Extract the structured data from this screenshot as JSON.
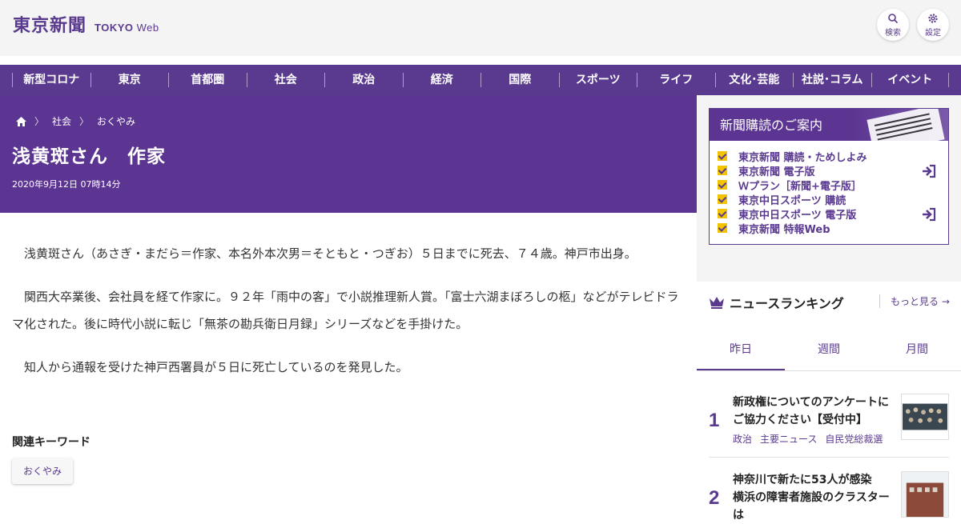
{
  "header": {
    "logo_jp": "東京新聞",
    "logo_en_bold": "TOKYO",
    "logo_en_light": "Web",
    "search_label": "検索",
    "settings_label": "設定"
  },
  "nav": [
    "新型コロナ",
    "東京",
    "首都圏",
    "社会",
    "政治",
    "経済",
    "国際",
    "スポーツ",
    "ライフ",
    "文化･芸能",
    "社説･コラム",
    "イベント"
  ],
  "breadcrumb": {
    "section": "社会",
    "page": "おくやみ"
  },
  "article": {
    "title": "浅黄斑さん　作家",
    "date": "2020年9月12日 07時14分",
    "paragraphs": [
      "浅黄斑さん（あさぎ・まだら＝作家、本名外本次男＝そともと・つぎお）５日までに死去、７４歳。神戸市出身。",
      "関西大卒業後、会社員を経て作家に。９２年「雨中の客」で小説推理新人賞。「富士六湖まぼろしの柩」などがテレビドラマ化された。後に時代小説に転じ「無茶の勘兵衛日月録」シリーズなどを手掛けた。",
      "知人から通報を受けた神戸西署員が５日に死亡しているのを発見した。"
    ],
    "keywords_heading": "関連キーワード",
    "keyword": "おくやみ"
  },
  "subscription": {
    "heading": "新聞購読のご案内",
    "items": [
      "東京新聞 購読・ためしよみ",
      "東京新聞 電子版",
      "Ｗプラン［新聞+電子版］",
      "東京中日スポーツ 購読",
      "東京中日スポーツ 電子版",
      "東京新聞 特報Web"
    ]
  },
  "ranking": {
    "heading": "ニュースランキング",
    "more": "もっと見る",
    "tabs": [
      "昨日",
      "週間",
      "月間"
    ],
    "items": [
      {
        "rank": "1",
        "title": "新政権についてのアンケートにご協力ください【受付中】",
        "cats": [
          "政治",
          "主要ニュース",
          "自民党総裁選"
        ]
      },
      {
        "rank": "2",
        "title": "神奈川で新たに53人が感染　横浜の障害者施設のクラスターは"
      }
    ]
  },
  "colors": {
    "brand": "#5a3a8e",
    "accent_check": "#f2c300"
  }
}
